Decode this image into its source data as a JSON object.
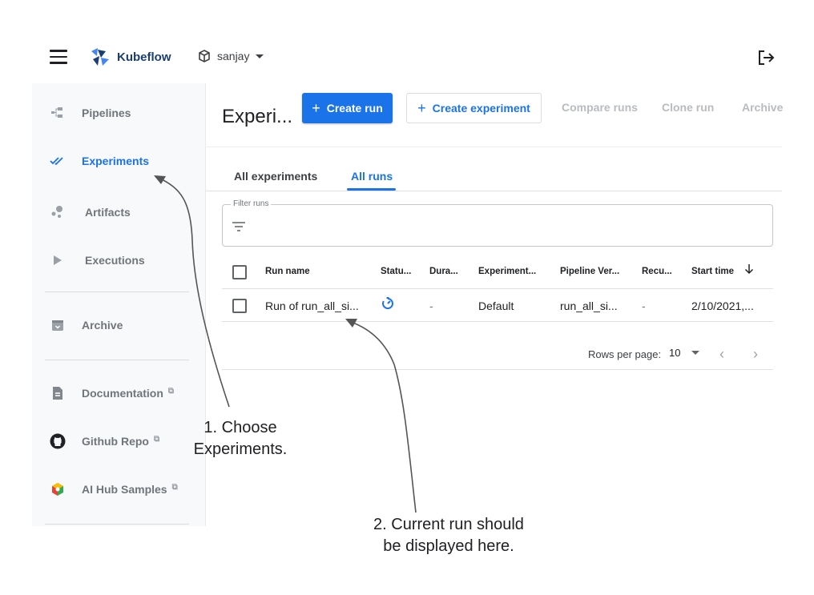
{
  "header": {
    "app_name": "Kubeflow",
    "namespace": "sanjay",
    "icons": {
      "menu": "hamburger-menu-icon",
      "logo": "kubeflow-logo-icon",
      "namespace": "cube-icon",
      "logout": "logout-icon"
    }
  },
  "sidebar": {
    "items": [
      {
        "label": "Pipelines",
        "icon": "pipelines-icon",
        "active": false
      },
      {
        "label": "Experiments",
        "icon": "experiments-checkmarks-icon",
        "active": true
      },
      {
        "label": "Artifacts",
        "icon": "artifacts-icon",
        "active": false
      },
      {
        "label": "Executions",
        "icon": "play-icon",
        "active": false
      },
      {
        "label": "Archive",
        "icon": "archive-icon",
        "active": false
      },
      {
        "label": "Documentation",
        "icon": "document-icon",
        "external": true
      },
      {
        "label": "Github Repo",
        "icon": "github-icon",
        "external": true
      },
      {
        "label": "AI Hub Samples",
        "icon": "ai-hub-icon",
        "external": true
      }
    ]
  },
  "main": {
    "title": "Experi...",
    "toolbar": {
      "create_run": "Create run",
      "create_experiment": "Create experiment",
      "compare_runs": "Compare runs",
      "clone_run": "Clone run",
      "archive": "Archive"
    },
    "tabs": [
      {
        "label": "All experiments",
        "active": false
      },
      {
        "label": "All runs",
        "active": true
      }
    ],
    "filter": {
      "label": "Filter runs",
      "value": ""
    },
    "table": {
      "columns": [
        "Run name",
        "Statu...",
        "Dura...",
        "Experiment...",
        "Pipeline Ver...",
        "Recu...",
        "Start time"
      ],
      "rows": [
        {
          "run_name": "Run of run_all_si...",
          "status": "running",
          "duration": "-",
          "experiment": "Default",
          "pipeline_version": "run_all_si...",
          "recurring": "-",
          "start_time": "2/10/2021,..."
        }
      ]
    },
    "pagination": {
      "rows_per_page_label": "Rows per page:",
      "rows_per_page": "10"
    }
  },
  "annotations": {
    "step1_line1": "1. Choose",
    "step1_line2": "Experiments.",
    "step2_line1": "2. Current run should",
    "step2_line2": "be displayed here."
  },
  "colors": {
    "accent": "#1a73e8",
    "sidebar_bg": "#f8f9fa",
    "brand": "#1a3e72"
  }
}
